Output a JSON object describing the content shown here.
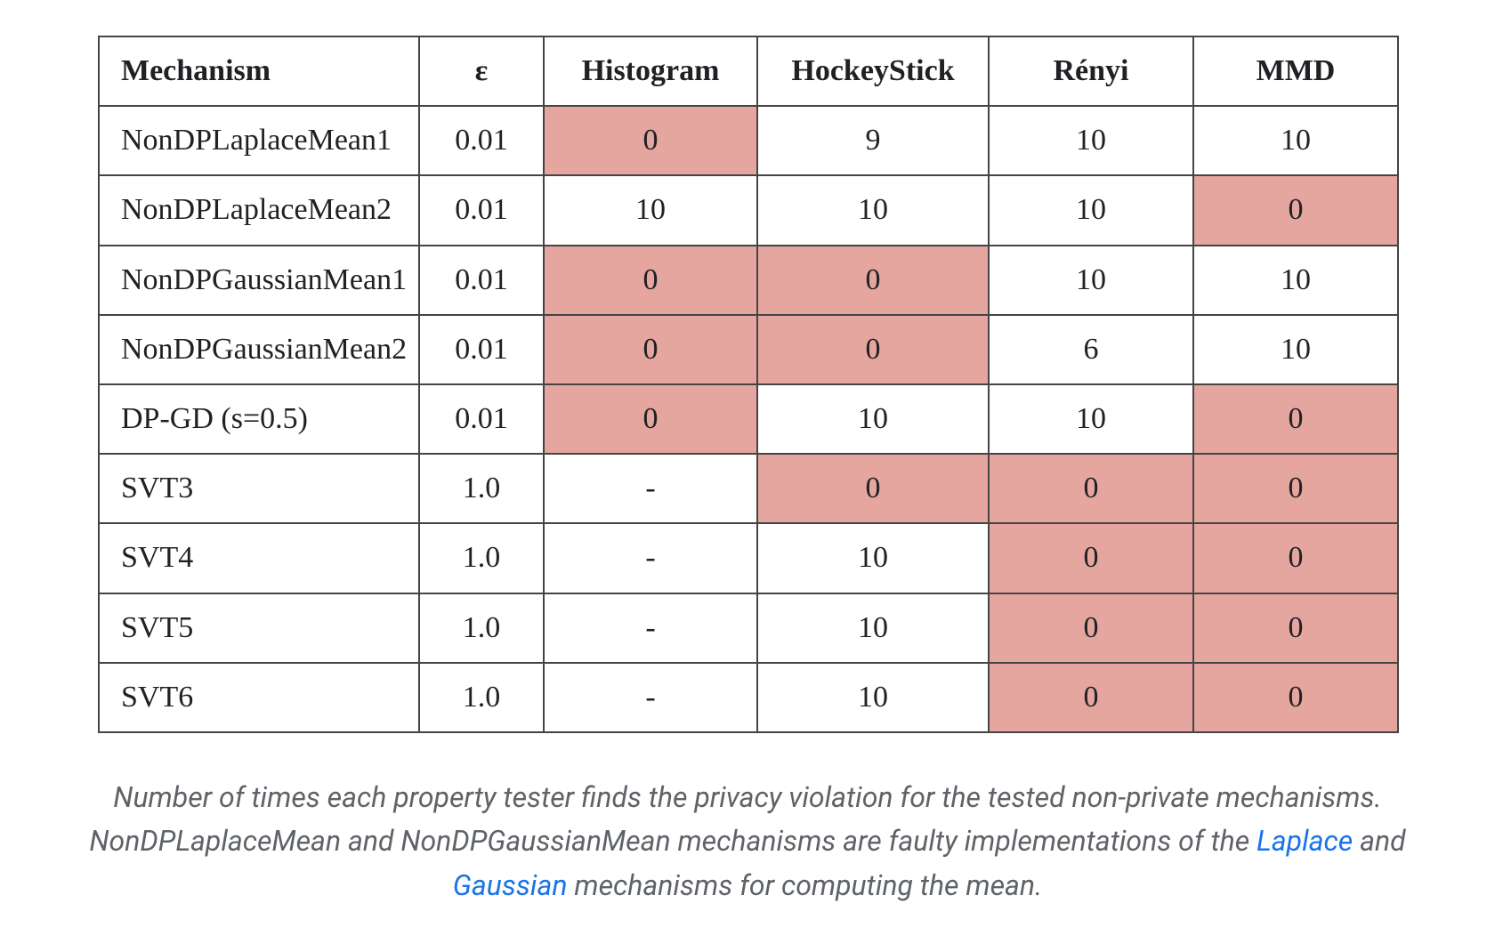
{
  "chart_data": {
    "type": "table",
    "headers": [
      "Mechanism",
      "ε",
      "Histogram",
      "HockeyStick",
      "Rényi",
      "MMD"
    ],
    "highlight_color": "#e6a6a0",
    "rows": [
      {
        "mechanism": "NonDPLaplaceMean1",
        "eps": "0.01",
        "cells": [
          {
            "v": "0",
            "hl": true
          },
          {
            "v": "9",
            "hl": false
          },
          {
            "v": "10",
            "hl": false
          },
          {
            "v": "10",
            "hl": false
          }
        ]
      },
      {
        "mechanism": "NonDPLaplaceMean2",
        "eps": "0.01",
        "cells": [
          {
            "v": "10",
            "hl": false
          },
          {
            "v": "10",
            "hl": false
          },
          {
            "v": "10",
            "hl": false
          },
          {
            "v": "0",
            "hl": true
          }
        ]
      },
      {
        "mechanism": "NonDPGaussianMean1",
        "eps": "0.01",
        "cells": [
          {
            "v": "0",
            "hl": true
          },
          {
            "v": "0",
            "hl": true
          },
          {
            "v": "10",
            "hl": false
          },
          {
            "v": "10",
            "hl": false
          }
        ]
      },
      {
        "mechanism": "NonDPGaussianMean2",
        "eps": "0.01",
        "cells": [
          {
            "v": "0",
            "hl": true
          },
          {
            "v": "0",
            "hl": true
          },
          {
            "v": "6",
            "hl": false
          },
          {
            "v": "10",
            "hl": false
          }
        ]
      },
      {
        "mechanism": "DP-GD (s=0.5)",
        "eps": "0.01",
        "cells": [
          {
            "v": "0",
            "hl": true
          },
          {
            "v": "10",
            "hl": false
          },
          {
            "v": "10",
            "hl": false
          },
          {
            "v": "0",
            "hl": true
          }
        ]
      },
      {
        "mechanism": "SVT3",
        "eps": "1.0",
        "cells": [
          {
            "v": "-",
            "hl": false
          },
          {
            "v": "0",
            "hl": true
          },
          {
            "v": "0",
            "hl": true
          },
          {
            "v": "0",
            "hl": true
          }
        ]
      },
      {
        "mechanism": "SVT4",
        "eps": "1.0",
        "cells": [
          {
            "v": "-",
            "hl": false
          },
          {
            "v": "10",
            "hl": false
          },
          {
            "v": "0",
            "hl": true
          },
          {
            "v": "0",
            "hl": true
          }
        ]
      },
      {
        "mechanism": "SVT5",
        "eps": "1.0",
        "cells": [
          {
            "v": "-",
            "hl": false
          },
          {
            "v": "10",
            "hl": false
          },
          {
            "v": "0",
            "hl": true
          },
          {
            "v": "0",
            "hl": true
          }
        ]
      },
      {
        "mechanism": "SVT6",
        "eps": "1.0",
        "cells": [
          {
            "v": "-",
            "hl": false
          },
          {
            "v": "10",
            "hl": false
          },
          {
            "v": "0",
            "hl": true
          },
          {
            "v": "0",
            "hl": true
          }
        ]
      }
    ]
  },
  "caption": {
    "p1": "Number of times each property tester finds the privacy violation for the tested non-private mechanisms. NonDPLaplaceMean and NonDPGaussianMean mechanisms are faulty implementations of the ",
    "link1": "Laplace",
    "p2": " and ",
    "link2": "Gaussian",
    "p3": " mechanisms for computing the mean."
  }
}
